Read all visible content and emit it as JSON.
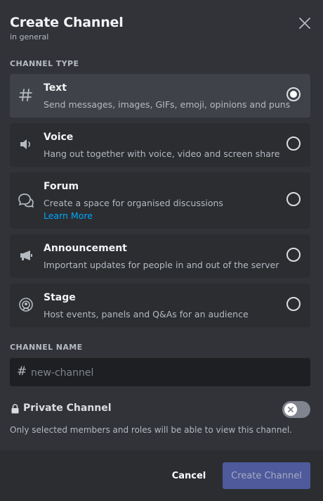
{
  "colors": {
    "background": "#313338",
    "card": "#2b2d31",
    "card_selected": "#404249",
    "input": "#1e1f22",
    "link": "#00a8fc",
    "primary_disabled": "#4e5a9c",
    "text_muted": "#b5bac1"
  },
  "header": {
    "title": "Create Channel",
    "subtitle": "in general",
    "close_icon": "close-icon"
  },
  "channel_type": {
    "label": "CHANNEL TYPE",
    "selected": "text",
    "items": [
      {
        "id": "text",
        "icon": "hash-icon",
        "name": "Text",
        "description": "Send messages, images, GIFs, emoji, opinions and puns",
        "checked": true
      },
      {
        "id": "voice",
        "icon": "speaker-icon",
        "name": "Voice",
        "description": "Hang out together with voice, video and screen share",
        "checked": false
      },
      {
        "id": "forum",
        "icon": "forum-icon",
        "name": "Forum",
        "description": "Create a space for organised discussions",
        "link": "Learn More",
        "checked": false
      },
      {
        "id": "announcement",
        "icon": "megaphone-icon",
        "name": "Announcement",
        "description": "Important updates for people in and out of the server",
        "checked": false
      },
      {
        "id": "stage",
        "icon": "stage-icon",
        "name": "Stage",
        "description": "Host events, panels and Q&As for an audience",
        "checked": false
      }
    ]
  },
  "channel_name": {
    "label": "CHANNEL NAME",
    "prefix": "#",
    "placeholder": "new-channel",
    "value": ""
  },
  "private_channel": {
    "label": "Private Channel",
    "enabled": false,
    "note": "Only selected members and roles will be able to view this channel."
  },
  "footer": {
    "cancel_label": "Cancel",
    "create_label": "Create Channel"
  }
}
